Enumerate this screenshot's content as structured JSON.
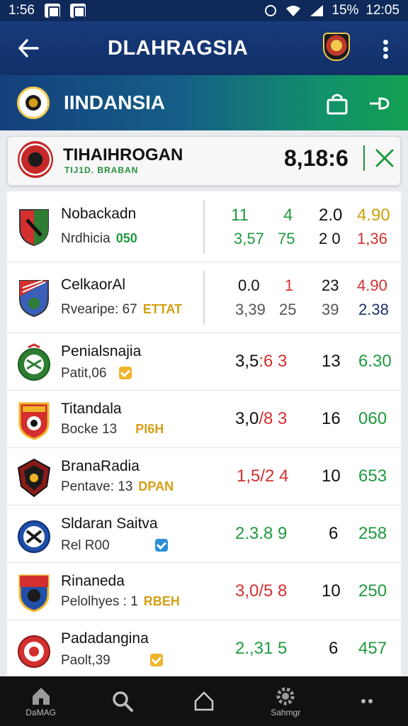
{
  "status_bar": {
    "time": "1:56",
    "battery": "15%",
    "clock": "12:05"
  },
  "header": {
    "title": "DLAHRAGSIA",
    "icons": [
      "back-arrow-icon",
      "club-crest-icon",
      "more-vert-icon"
    ]
  },
  "league": {
    "name": "IINDANSIA",
    "icons": [
      "league-logo-icon",
      "shopping-bag-icon",
      "pin-icon"
    ]
  },
  "featured": {
    "title": "TIHAIHROGAN",
    "subtitle": "TIJ1D. BRABAN",
    "odds": "8,18:6"
  },
  "rows": [
    {
      "team": "Nobackadn",
      "meta": "Nrdhicia",
      "tag": "050",
      "tag_color": "green",
      "top": [
        {
          "v": "11",
          "c": "g"
        },
        {
          "v": "4",
          "c": "g"
        },
        {
          "v": "2.0",
          "c": "k"
        },
        {
          "v": "4.90",
          "c": "y"
        }
      ],
      "bottom": [
        {
          "v": "3,57",
          "c": "g"
        },
        {
          "v": "75",
          "c": "g"
        },
        {
          "v": "2 0",
          "c": "k"
        },
        {
          "v": "1,36",
          "c": "r"
        }
      ]
    },
    {
      "team": "CelkaorAl",
      "meta": "Rvearipe: 67",
      "tag": "ETTAT",
      "tag_color": "gold",
      "top": [
        {
          "v": "0.0",
          "c": "k"
        },
        {
          "v": "1",
          "c": "r"
        },
        {
          "v": "23",
          "c": "k"
        },
        {
          "v": "4.90",
          "c": "r"
        }
      ],
      "bottom": [
        {
          "v": "3,39",
          "c": "k"
        },
        {
          "v": "25",
          "c": "k"
        },
        {
          "v": "39",
          "c": "k"
        },
        {
          "v": "2.38",
          "c": "n"
        }
      ]
    },
    {
      "team": "Penialsnajia",
      "meta": "Patit,06",
      "check": "gold",
      "odds": [
        {
          "v": "3,5",
          "c": "k"
        },
        {
          "v": ":6 3",
          "c": "r"
        }
      ],
      "num": "13",
      "val": "6.30",
      "val_c": "g"
    },
    {
      "team": "Titandala",
      "meta": "Bocke 13",
      "tag": "PI6H",
      "tag_color": "gold",
      "odds": [
        {
          "v": "3,0",
          "c": "k"
        },
        {
          "v": "/8 3",
          "c": "r"
        }
      ],
      "num": "16",
      "val": "060",
      "val_c": "g"
    },
    {
      "team": "BranaRadia",
      "meta": "Pentave: 13",
      "tag": "DPAN",
      "tag_color": "gold",
      "odds": [
        {
          "v": "1,5/2 4",
          "c": "r"
        }
      ],
      "num": "10",
      "val": "653",
      "val_c": "g"
    },
    {
      "team": "Sldaran Saitva",
      "meta": "Rel R00",
      "check": "blue",
      "odds": [
        {
          "v": "2.3.8 9",
          "c": "g"
        }
      ],
      "num": "6",
      "val": "258",
      "val_c": "g"
    },
    {
      "team": "Rinaneda",
      "meta": "Pelolhyes : 1",
      "tag": "RBEH",
      "tag_color": "gold",
      "odds": [
        {
          "v": "3,0/5 8",
          "c": "r"
        }
      ],
      "num": "10",
      "val": "250",
      "val_c": "g"
    },
    {
      "team": "Padadangina",
      "meta": "Paolt,39",
      "check": "gold",
      "odds": [
        {
          "v": "2.,31 5",
          "c": "g"
        }
      ],
      "num": "6",
      "val": "457",
      "val_c": "g"
    }
  ],
  "bottom_nav": [
    {
      "label": "DaMAG",
      "icon": "home-icon"
    },
    {
      "label": "",
      "icon": "search-icon"
    },
    {
      "label": "",
      "icon": "outline-home-icon"
    },
    {
      "label": "Sahmgr",
      "icon": "settings-icon"
    },
    {
      "label": "",
      "icon": "more-horiz-icon"
    }
  ]
}
